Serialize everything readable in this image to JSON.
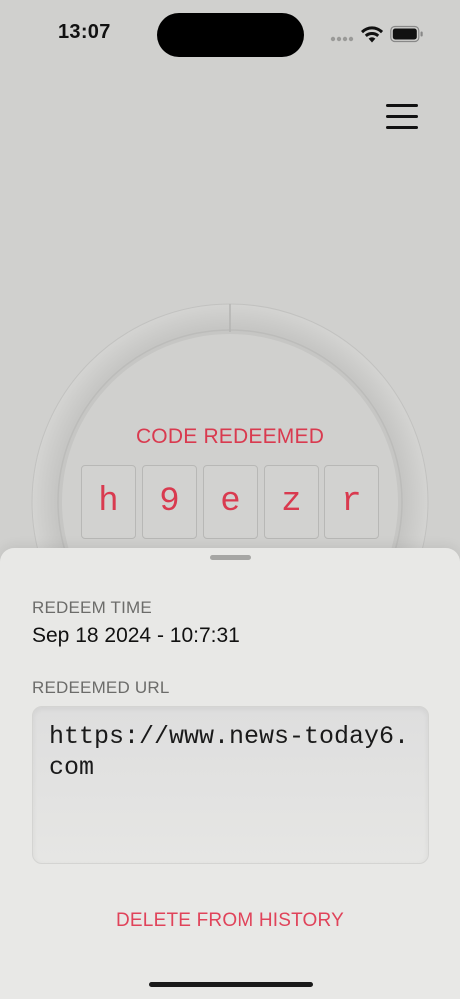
{
  "status_bar": {
    "time": "13:07"
  },
  "menu": {
    "icon": "hamburger-menu-icon"
  },
  "redeem_panel": {
    "status_label": "CODE REDEEMED",
    "code_chars": [
      "h",
      "9",
      "e",
      "z",
      "r"
    ],
    "progress": 0.0,
    "accent_color": "#d93a4f"
  },
  "details_sheet": {
    "redeem_time_label": "REDEEM TIME",
    "redeem_time_value": "Sep 18 2024 - 10:7:31",
    "redeemed_url_label": "REDEEMED URL",
    "redeemed_url_value": "https://www.news-today6.com",
    "delete_label": "DELETE FROM HISTORY",
    "delete_color": "#e0435a"
  }
}
